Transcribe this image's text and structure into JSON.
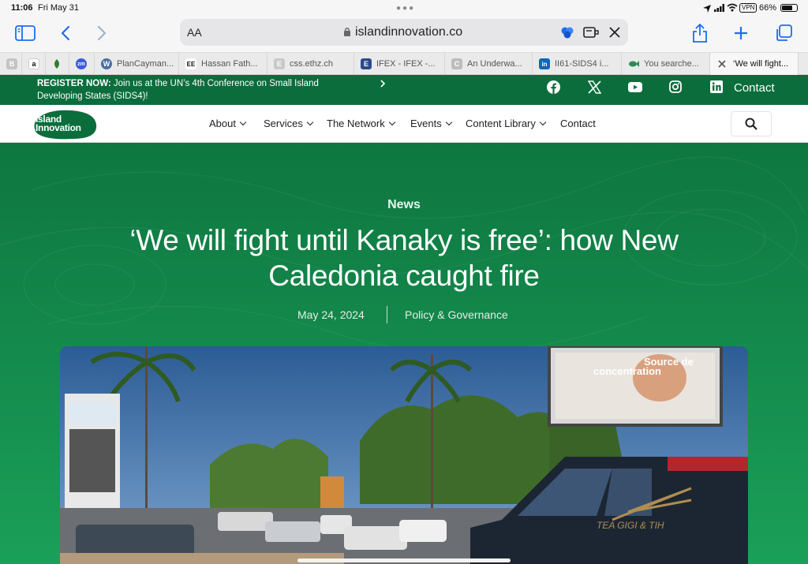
{
  "status_bar": {
    "time": "11:06",
    "date": "Fri May 31",
    "vpn": "VPN",
    "battery": "66%"
  },
  "browser": {
    "text_size_label": "AA",
    "url": "islandinnovation.co",
    "tabs": [
      {
        "favicon": "B",
        "title": "",
        "favicon_color": "#bdbdbd"
      },
      {
        "favicon": "a",
        "title": "",
        "favicon_color": "#ffffff"
      },
      {
        "favicon": "leaf",
        "title": "",
        "favicon_color": "#eaeaea"
      },
      {
        "favicon": "zm",
        "title": "",
        "favicon_color": "#3b5bdb"
      },
      {
        "favicon": "W",
        "title": "PlanCayman...",
        "favicon_color": "#4a6fa5"
      },
      {
        "favicon": "EE",
        "title": "Hassan Fath...",
        "favicon_color": "#ffffff"
      },
      {
        "favicon": "E",
        "title": "css.ethz.ch",
        "favicon_color": "#c9c9c9"
      },
      {
        "favicon": "E",
        "title": "IFEX - IFEX -...",
        "favicon_color": "#2b4a8a"
      },
      {
        "favicon": "C",
        "title": "An Underwa...",
        "favicon_color": "#bdbdbd"
      },
      {
        "favicon": "in",
        "title": "II61-SIDS4 i...",
        "favicon_color": "#0a66c2"
      },
      {
        "favicon": "fish",
        "title": "You searche...",
        "favicon_color": "#eaeaea"
      },
      {
        "favicon": "x",
        "title": "‘We will fight...",
        "favicon_color": "#eaeaea"
      }
    ]
  },
  "site": {
    "announcement": {
      "strong": "REGISTER NOW:",
      "line1": " Join us at the UN’s 4th Conference on Small Island",
      "line2": "Developing States (SIDS4)!"
    },
    "social": [
      "facebook-icon",
      "x-icon",
      "youtube-icon",
      "instagram-icon",
      "linkedin-icon"
    ],
    "top_contact": "Contact",
    "logo": {
      "line1": "Island",
      "line2": "Innovation"
    },
    "nav": [
      {
        "label": "About",
        "dropdown": true
      },
      {
        "label": "Services",
        "dropdown": true
      },
      {
        "label": "The Network",
        "dropdown": true
      },
      {
        "label": "Events",
        "dropdown": true
      },
      {
        "label": "Content Library",
        "dropdown": true
      },
      {
        "label": "Contact",
        "dropdown": false
      }
    ]
  },
  "article": {
    "category": "News",
    "title": "‘We will fight until Kanaky is free’: how New Caledonia caught fire",
    "date": "May 24, 2024",
    "topic": "Policy & Governance",
    "image": {
      "billboard_line1": "Source de",
      "billboard_line2": "concentration",
      "truck_text": "TEA GIGI & TIH"
    }
  },
  "colors": {
    "brand_green": "#0b6d3c",
    "hero_green": "#13864a",
    "ios_blue": "#1b6ef3"
  }
}
